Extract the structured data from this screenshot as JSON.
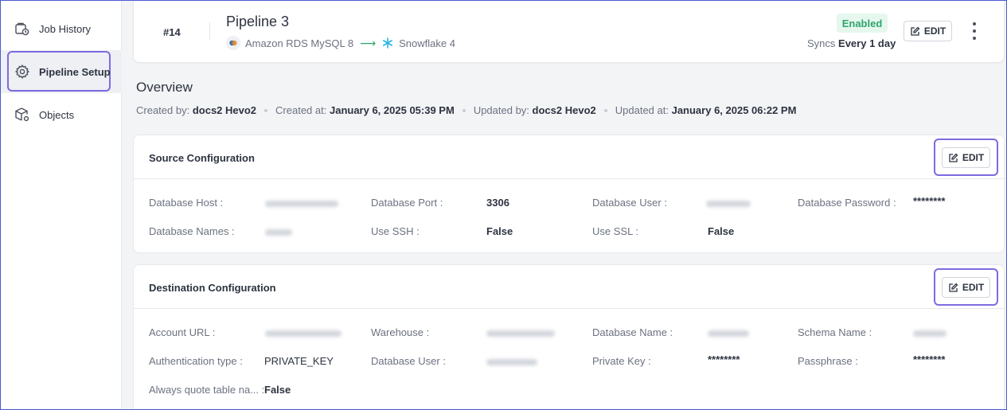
{
  "sidebar": {
    "items": [
      {
        "label": "Job History",
        "icon": "job-history-icon"
      },
      {
        "label": "Pipeline Setup",
        "icon": "gear-icon",
        "active": true
      },
      {
        "label": "Objects",
        "icon": "objects-icon"
      }
    ]
  },
  "header": {
    "pipeline_number": "#14",
    "pipeline_name": "Pipeline 3",
    "source": "Amazon RDS MySQL 8",
    "destination": "Snowflake 4",
    "status": "Enabled",
    "sync_label": "Syncs",
    "sync_value": "Every 1 day",
    "edit_label": "EDIT"
  },
  "overview": {
    "title": "Overview",
    "created_by_label": "Created by:",
    "created_by": "docs2 Hevo2",
    "created_at_label": "Created at:",
    "created_at": "January 6, 2025 05:39 PM",
    "updated_by_label": "Updated by:",
    "updated_by": "docs2 Hevo2",
    "updated_at_label": "Updated at:",
    "updated_at": "January 6, 2025 06:22 PM"
  },
  "source_config": {
    "title": "Source Configuration",
    "edit_label": "EDIT",
    "fields": {
      "db_host_label": "Database Host :",
      "db_port_label": "Database Port :",
      "db_port": "3306",
      "db_user_label": "Database User :",
      "db_password_label": "Database Password :",
      "db_password": "********",
      "db_names_label": "Database Names :",
      "use_ssh_label": "Use SSH :",
      "use_ssh": "False",
      "use_ssl_label": "Use SSL :",
      "use_ssl": "False"
    }
  },
  "dest_config": {
    "title": "Destination Configuration",
    "edit_label": "EDIT",
    "fields": {
      "account_url_label": "Account URL :",
      "warehouse_label": "Warehouse :",
      "db_name_label": "Database Name :",
      "schema_name_label": "Schema Name :",
      "auth_type_label": "Authentication type :",
      "auth_type": "PRIVATE_KEY",
      "db_user_label": "Database User :",
      "private_key_label": "Private Key :",
      "private_key": "********",
      "passphrase_label": "Passphrase :",
      "passphrase": "********",
      "quote_label": "Always quote table na...  :",
      "quote": "False"
    }
  },
  "colors": {
    "accent_outline": "#7b6be0",
    "status_green": "#2fa56b",
    "snowflake_blue": "#29b5e8"
  }
}
